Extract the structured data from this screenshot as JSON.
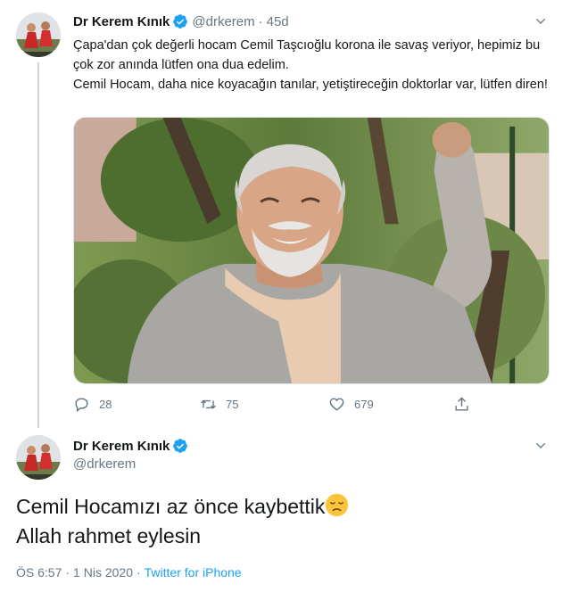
{
  "tweet": {
    "author_name": "Dr Kerem Kınık",
    "handle": "@drkerem",
    "separator": "·",
    "time": "45d",
    "text_line1": "Çapa'dan çok değerli hocam Cemil Taşcıoğlu korona ile savaş veriyor, hepimiz bu çok zor anında lütfen ona dua edelim.",
    "text_line2": "Cemil Hocam, daha nice koyacağın tanılar, yetiştireceğin doktorlar var, lütfen diren!",
    "replies": "28",
    "retweets": "75",
    "likes": "679",
    "icons": {
      "verified": "verified-badge-icon",
      "more": "chevron-down-icon",
      "reply": "reply-icon",
      "retweet": "retweet-icon",
      "like": "heart-icon",
      "share": "share-icon"
    }
  },
  "reply_tweet": {
    "author_name": "Dr Kerem Kınık",
    "handle": "@drkerem",
    "text_line1": "Cemil Hocamızı az önce kaybettik",
    "text_line2": "Allah rahmet eylesin",
    "emoji": "disappointed-face-emoji",
    "time": "ÖS 6:57",
    "date": "1 Nis 2020",
    "separator": "·",
    "source": "Twitter for iPhone"
  },
  "colors": {
    "accent": "#1da1f2",
    "text": "#14171a",
    "muted": "#657786",
    "divider": "#ccd6dd"
  }
}
